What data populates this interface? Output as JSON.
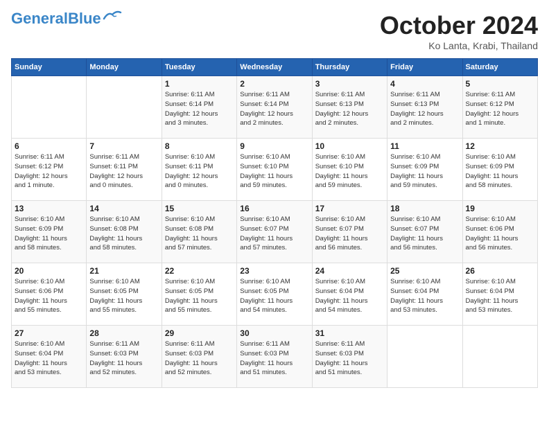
{
  "header": {
    "logo_general": "General",
    "logo_blue": "Blue",
    "month_title": "October 2024",
    "location": "Ko Lanta, Krabi, Thailand"
  },
  "days_of_week": [
    "Sunday",
    "Monday",
    "Tuesday",
    "Wednesday",
    "Thursday",
    "Friday",
    "Saturday"
  ],
  "weeks": [
    [
      {
        "day": "",
        "info": ""
      },
      {
        "day": "",
        "info": ""
      },
      {
        "day": "1",
        "info": "Sunrise: 6:11 AM\nSunset: 6:14 PM\nDaylight: 12 hours\nand 3 minutes."
      },
      {
        "day": "2",
        "info": "Sunrise: 6:11 AM\nSunset: 6:14 PM\nDaylight: 12 hours\nand 2 minutes."
      },
      {
        "day": "3",
        "info": "Sunrise: 6:11 AM\nSunset: 6:13 PM\nDaylight: 12 hours\nand 2 minutes."
      },
      {
        "day": "4",
        "info": "Sunrise: 6:11 AM\nSunset: 6:13 PM\nDaylight: 12 hours\nand 2 minutes."
      },
      {
        "day": "5",
        "info": "Sunrise: 6:11 AM\nSunset: 6:12 PM\nDaylight: 12 hours\nand 1 minute."
      }
    ],
    [
      {
        "day": "6",
        "info": "Sunrise: 6:11 AM\nSunset: 6:12 PM\nDaylight: 12 hours\nand 1 minute."
      },
      {
        "day": "7",
        "info": "Sunrise: 6:11 AM\nSunset: 6:11 PM\nDaylight: 12 hours\nand 0 minutes."
      },
      {
        "day": "8",
        "info": "Sunrise: 6:10 AM\nSunset: 6:11 PM\nDaylight: 12 hours\nand 0 minutes."
      },
      {
        "day": "9",
        "info": "Sunrise: 6:10 AM\nSunset: 6:10 PM\nDaylight: 11 hours\nand 59 minutes."
      },
      {
        "day": "10",
        "info": "Sunrise: 6:10 AM\nSunset: 6:10 PM\nDaylight: 11 hours\nand 59 minutes."
      },
      {
        "day": "11",
        "info": "Sunrise: 6:10 AM\nSunset: 6:09 PM\nDaylight: 11 hours\nand 59 minutes."
      },
      {
        "day": "12",
        "info": "Sunrise: 6:10 AM\nSunset: 6:09 PM\nDaylight: 11 hours\nand 58 minutes."
      }
    ],
    [
      {
        "day": "13",
        "info": "Sunrise: 6:10 AM\nSunset: 6:09 PM\nDaylight: 11 hours\nand 58 minutes."
      },
      {
        "day": "14",
        "info": "Sunrise: 6:10 AM\nSunset: 6:08 PM\nDaylight: 11 hours\nand 58 minutes."
      },
      {
        "day": "15",
        "info": "Sunrise: 6:10 AM\nSunset: 6:08 PM\nDaylight: 11 hours\nand 57 minutes."
      },
      {
        "day": "16",
        "info": "Sunrise: 6:10 AM\nSunset: 6:07 PM\nDaylight: 11 hours\nand 57 minutes."
      },
      {
        "day": "17",
        "info": "Sunrise: 6:10 AM\nSunset: 6:07 PM\nDaylight: 11 hours\nand 56 minutes."
      },
      {
        "day": "18",
        "info": "Sunrise: 6:10 AM\nSunset: 6:07 PM\nDaylight: 11 hours\nand 56 minutes."
      },
      {
        "day": "19",
        "info": "Sunrise: 6:10 AM\nSunset: 6:06 PM\nDaylight: 11 hours\nand 56 minutes."
      }
    ],
    [
      {
        "day": "20",
        "info": "Sunrise: 6:10 AM\nSunset: 6:06 PM\nDaylight: 11 hours\nand 55 minutes."
      },
      {
        "day": "21",
        "info": "Sunrise: 6:10 AM\nSunset: 6:05 PM\nDaylight: 11 hours\nand 55 minutes."
      },
      {
        "day": "22",
        "info": "Sunrise: 6:10 AM\nSunset: 6:05 PM\nDaylight: 11 hours\nand 55 minutes."
      },
      {
        "day": "23",
        "info": "Sunrise: 6:10 AM\nSunset: 6:05 PM\nDaylight: 11 hours\nand 54 minutes."
      },
      {
        "day": "24",
        "info": "Sunrise: 6:10 AM\nSunset: 6:04 PM\nDaylight: 11 hours\nand 54 minutes."
      },
      {
        "day": "25",
        "info": "Sunrise: 6:10 AM\nSunset: 6:04 PM\nDaylight: 11 hours\nand 53 minutes."
      },
      {
        "day": "26",
        "info": "Sunrise: 6:10 AM\nSunset: 6:04 PM\nDaylight: 11 hours\nand 53 minutes."
      }
    ],
    [
      {
        "day": "27",
        "info": "Sunrise: 6:10 AM\nSunset: 6:04 PM\nDaylight: 11 hours\nand 53 minutes."
      },
      {
        "day": "28",
        "info": "Sunrise: 6:11 AM\nSunset: 6:03 PM\nDaylight: 11 hours\nand 52 minutes."
      },
      {
        "day": "29",
        "info": "Sunrise: 6:11 AM\nSunset: 6:03 PM\nDaylight: 11 hours\nand 52 minutes."
      },
      {
        "day": "30",
        "info": "Sunrise: 6:11 AM\nSunset: 6:03 PM\nDaylight: 11 hours\nand 51 minutes."
      },
      {
        "day": "31",
        "info": "Sunrise: 6:11 AM\nSunset: 6:03 PM\nDaylight: 11 hours\nand 51 minutes."
      },
      {
        "day": "",
        "info": ""
      },
      {
        "day": "",
        "info": ""
      }
    ]
  ]
}
